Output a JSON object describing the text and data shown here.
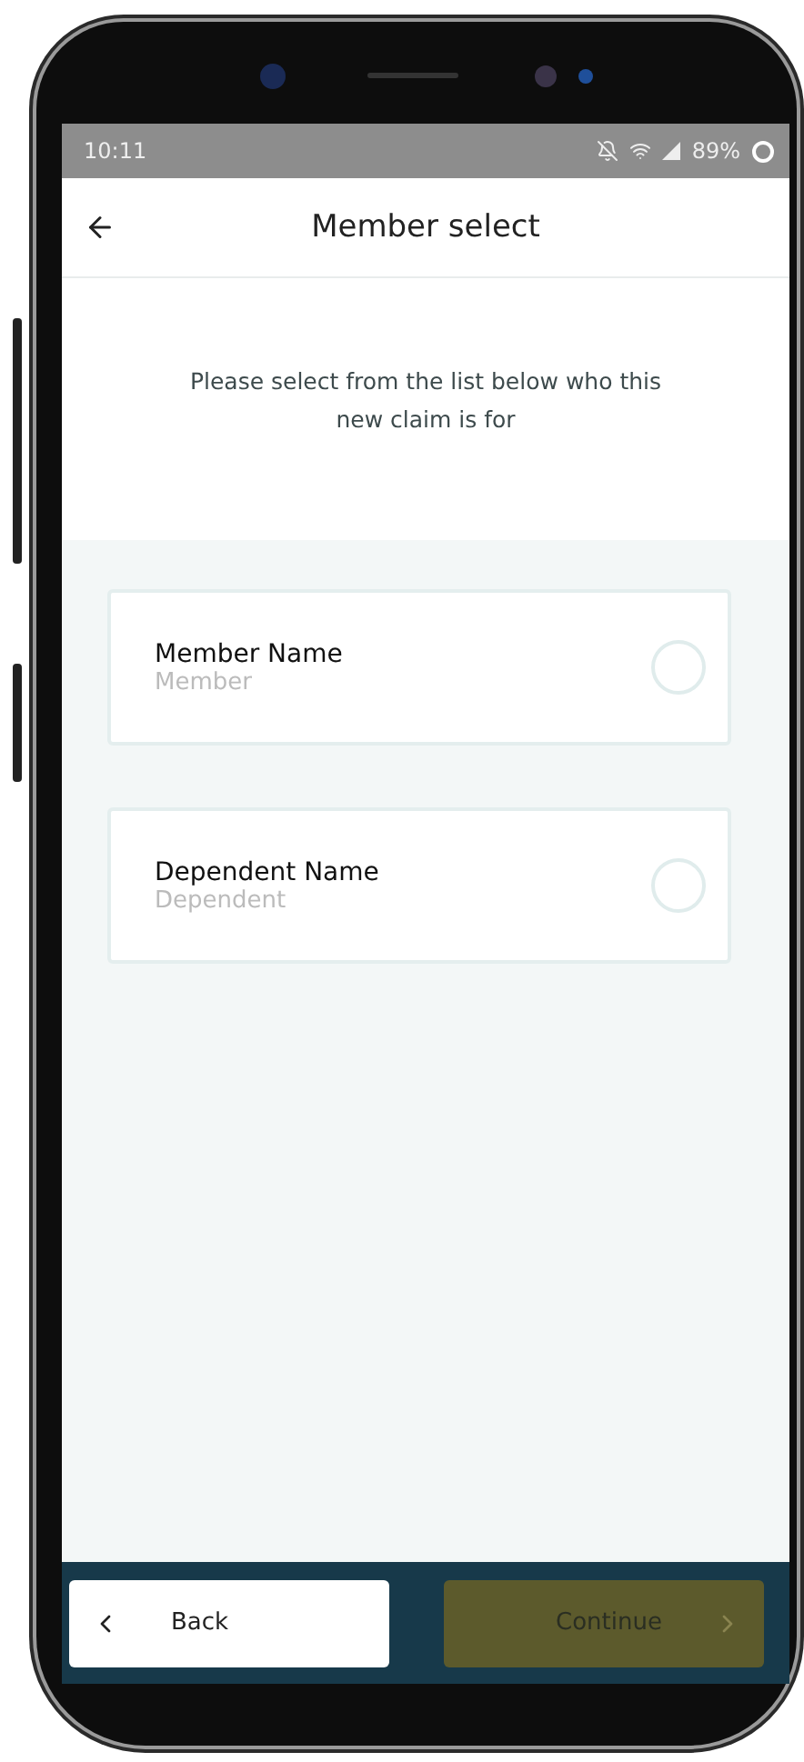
{
  "status_bar": {
    "time": "10:11",
    "battery": "89%"
  },
  "header": {
    "title": "Member select"
  },
  "intro": "Please select from the list below who this new claim is for",
  "members": [
    {
      "name": "Member Name",
      "role": "Member",
      "selected": false
    },
    {
      "name": "Dependent Name",
      "role": "Dependent",
      "selected": false
    }
  ],
  "footer": {
    "back": "Back",
    "continue": {
      "label": "Continue",
      "disabled": true
    }
  }
}
